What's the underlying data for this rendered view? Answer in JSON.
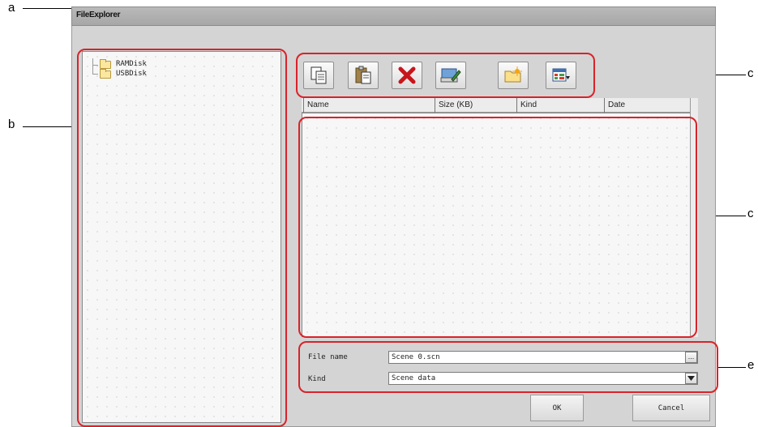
{
  "window": {
    "title": "FileExplorer"
  },
  "tree": {
    "items": [
      {
        "label": "RAMDisk",
        "icon": "folder-icon"
      },
      {
        "label": "USBDisk",
        "icon": "folder-icon"
      }
    ]
  },
  "toolbar": {
    "buttons": [
      {
        "name": "copy-button",
        "icon": "copy-icon"
      },
      {
        "name": "paste-button",
        "icon": "paste-icon"
      },
      {
        "name": "delete-button",
        "icon": "delete-icon"
      },
      {
        "name": "rename-button",
        "icon": "rename-icon"
      },
      {
        "name": "new-folder-button",
        "icon": "new-folder-icon"
      },
      {
        "name": "view-button",
        "icon": "view-icon"
      }
    ]
  },
  "file_list": {
    "columns": [
      "Name",
      "Size (KB)",
      "Kind",
      "Date"
    ],
    "rows": []
  },
  "file_name": {
    "label": "File name",
    "value": "Scene 0.scn",
    "button": "..."
  },
  "kind": {
    "label": "Kind",
    "value": "Scene data"
  },
  "buttons": {
    "ok": "OK",
    "cancel": "Cancel"
  },
  "callouts": {
    "a": "a",
    "b": "b",
    "c": "c",
    "d": "c",
    "e": "e"
  },
  "colors": {
    "highlight": "#d8232a"
  }
}
